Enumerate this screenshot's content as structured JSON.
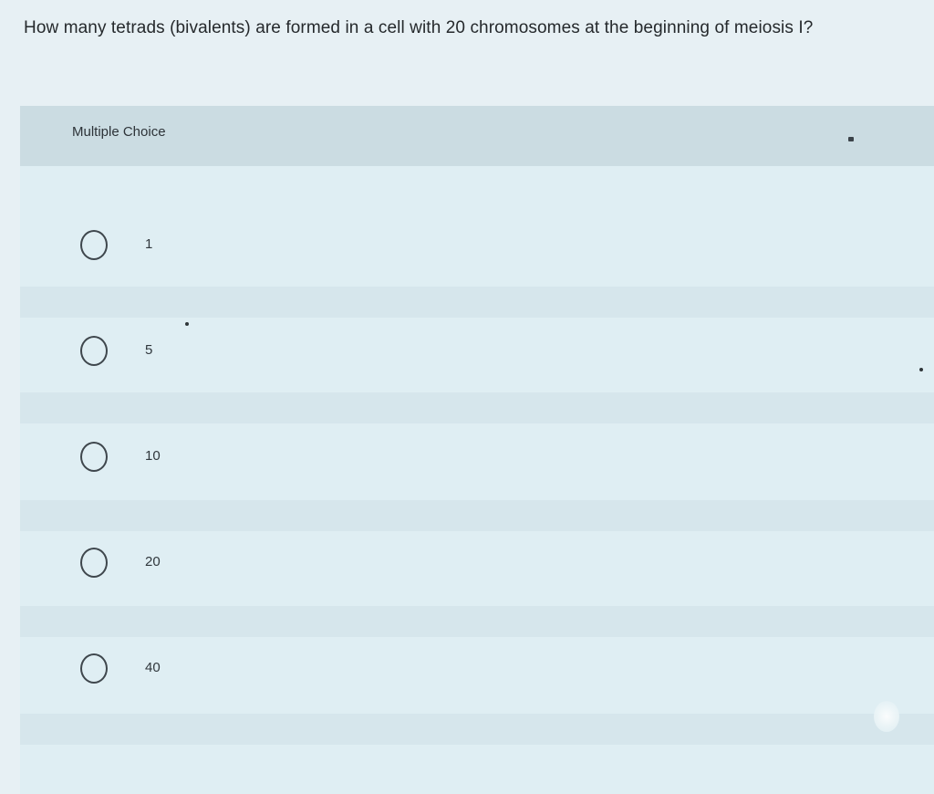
{
  "question": {
    "text": "How many tetrads (bivalents) are formed in a cell with 20 chromosomes at the beginning of meiosis I?"
  },
  "panel": {
    "header_label": "Multiple Choice"
  },
  "choices": [
    {
      "label": "1"
    },
    {
      "label": "5"
    },
    {
      "label": "10"
    },
    {
      "label": "20"
    },
    {
      "label": "40"
    }
  ],
  "colors": {
    "background": "#e7f0f4",
    "panel": "#dfeef3",
    "header": "#cbdce2",
    "text": "#2a3035"
  },
  "icons": {
    "radio": "radio-unselected-icon"
  }
}
